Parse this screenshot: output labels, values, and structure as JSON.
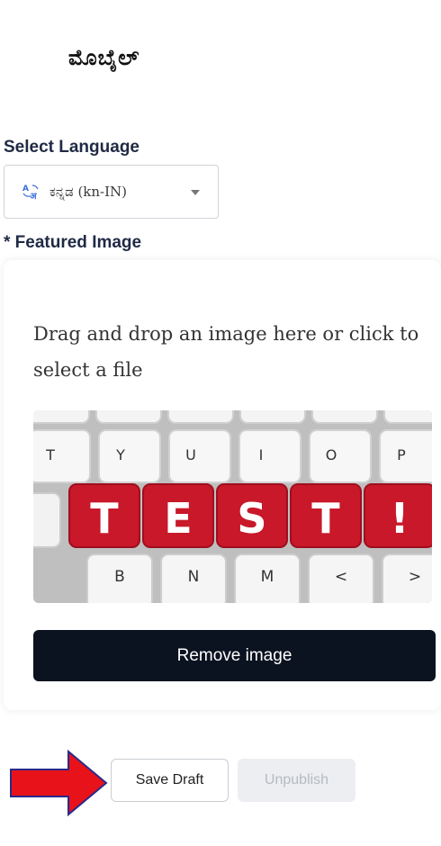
{
  "header": {
    "title": "ಮೊಬೈಲ್"
  },
  "language": {
    "label": "Select Language",
    "selected": "ಕನ್ನಡ (kn-IN)",
    "icon": "translate-icon"
  },
  "featured_image": {
    "label": "* Featured Image",
    "drop_text": "Drag and drop an image here or click to select a file",
    "preview_word": "TEST!",
    "preview_keys_top": [
      "T",
      "Y",
      "U",
      "I",
      "O",
      "P"
    ],
    "preview_keys_bottom": [
      "B",
      "N",
      "M",
      "<",
      ">"
    ],
    "remove_label": "Remove image"
  },
  "actions": {
    "save_draft_label": "Save Draft",
    "unpublish_label": "Unpublish",
    "unpublish_disabled": true
  },
  "colors": {
    "primary_dark": "#0b1220",
    "annotation_arrow": "#e8121b",
    "key_red": "#c8182a",
    "label_text": "#1f2a44"
  }
}
